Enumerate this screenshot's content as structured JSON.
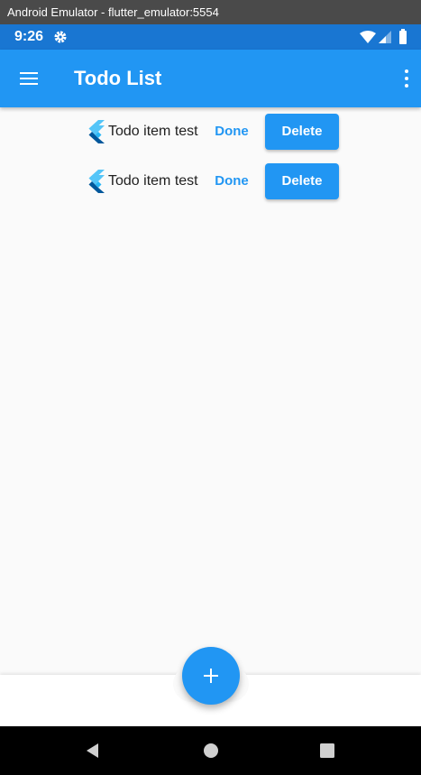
{
  "window": {
    "title": "Android Emulator - flutter_emulator:5554"
  },
  "status_bar": {
    "time": "9:26",
    "icons": [
      "gear-icon",
      "wifi-icon",
      "signal-icon",
      "battery-icon"
    ],
    "color": "#1976d2"
  },
  "app_bar": {
    "title": "Todo List",
    "menu_icon": "menu-icon",
    "more_icon": "more-vert-icon",
    "color": "#2196f3"
  },
  "todos": [
    {
      "text": "Todo item test",
      "done_label": "Done",
      "delete_label": "Delete",
      "icon": "flutter-logo-icon"
    },
    {
      "text": "Todo item test",
      "done_label": "Done",
      "delete_label": "Delete",
      "icon": "flutter-logo-icon"
    }
  ],
  "fab": {
    "icon": "add-icon",
    "color": "#2196f3"
  },
  "nav_bar": {
    "icons": [
      "back-icon",
      "home-icon",
      "recents-icon"
    ]
  }
}
